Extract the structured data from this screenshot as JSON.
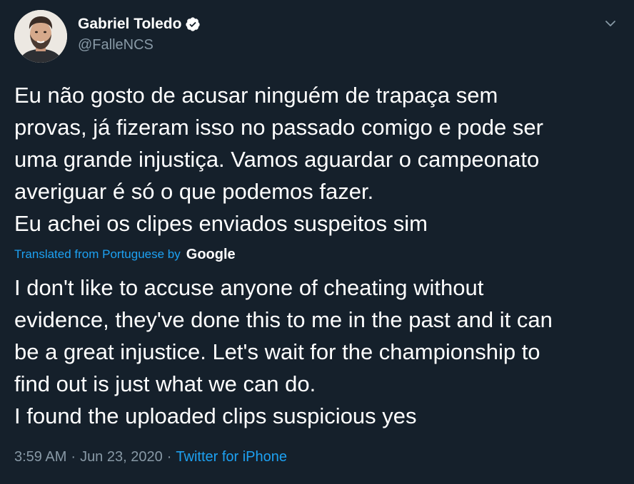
{
  "tweet": {
    "author": {
      "display_name": "Gabriel Toledo",
      "handle": "@FalleNCS",
      "verified": true
    },
    "original_text": "Eu não gosto de acusar ninguém de trapaça sem\nprovas, já fizeram isso no passado comigo e pode ser\numa grande injustiça. Vamos aguardar o campeonato\naveriguar é só o que podemos fazer.\nEu achei os clipes enviados suspeitos sim",
    "translation_label": "Translated from Portuguese by",
    "translation_provider": "Google",
    "translated_text": "I don't like to accuse anyone of cheating without\nevidence, they've done this to me in the past and it can\nbe a great injustice. Let's wait for the championship to\nfind out is just what we can do.\n I found the uploaded clips suspicious yes",
    "time": "3:59 AM",
    "date": "Jun 23, 2020",
    "separator": "·",
    "source": "Twitter for iPhone"
  },
  "icons": {
    "verified": "verified-badge-icon",
    "menu": "chevron-down-icon"
  },
  "colors": {
    "background": "#15202b",
    "text": "#ffffff",
    "secondary": "#8899a6",
    "accent": "#1da1f2"
  }
}
